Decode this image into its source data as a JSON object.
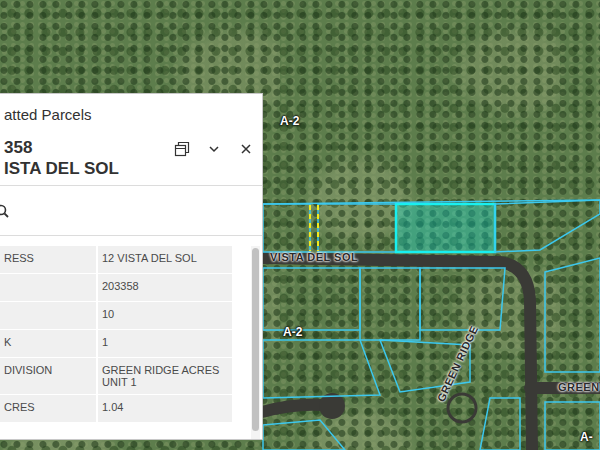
{
  "map": {
    "labels": [
      {
        "text": "A-2",
        "kind": "zone"
      },
      {
        "text": "VISTA DEL SOL",
        "kind": "road"
      },
      {
        "text": "A-2",
        "kind": "zone"
      },
      {
        "text": "GREEN RIDGE",
        "kind": "road"
      },
      {
        "text": "GREEN",
        "kind": "road"
      },
      {
        "text": "A-",
        "kind": "zone"
      }
    ],
    "parcels": [
      {
        "selected": false
      },
      {
        "selected": false
      },
      {
        "selected": true
      },
      {
        "selected": false
      },
      {
        "selected": false
      },
      {
        "selected": false
      },
      {
        "selected": false
      },
      {
        "selected": false
      },
      {
        "selected": false
      },
      {
        "selected": false
      },
      {
        "selected": false
      },
      {
        "selected": false
      },
      {
        "selected": false
      }
    ]
  },
  "popup": {
    "title": "atted Parcels",
    "heading": "358",
    "subheading": "ISTA DEL SOL",
    "fields": [
      {
        "label": "RESS",
        "value": "12 VISTA DEL SOL"
      },
      {
        "label": "",
        "value": "203358"
      },
      {
        "label": "",
        "value": "10"
      },
      {
        "label": "K",
        "value": "1"
      },
      {
        "label": "DIVISION",
        "value": "GREEN RIDGE ACRES UNIT 1"
      },
      {
        "label": "CRES",
        "value": "1.04"
      }
    ],
    "scrollbar": {
      "level": 0.95
    }
  }
}
